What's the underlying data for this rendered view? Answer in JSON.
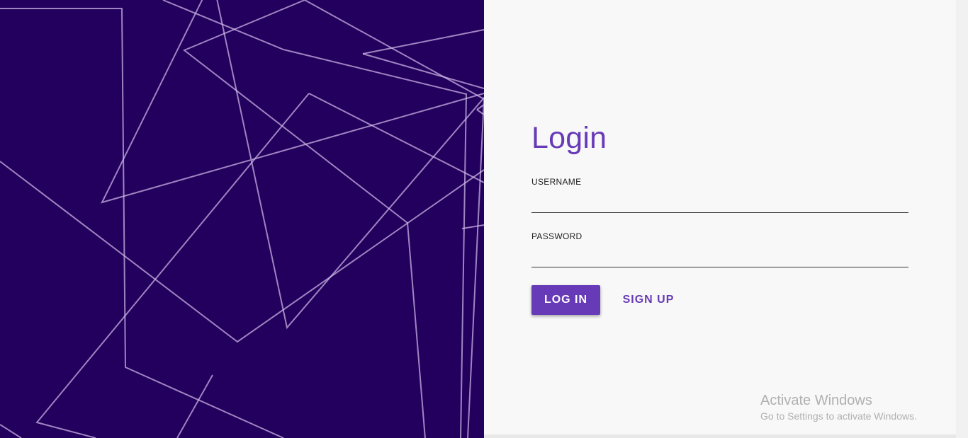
{
  "login": {
    "title": "Login",
    "username_label": "USERNAME",
    "username_value": "",
    "password_label": "PASSWORD",
    "password_value": "",
    "login_button": "LOG IN",
    "signup_button": "SIGN UP"
  },
  "watermark": {
    "title": "Activate Windows",
    "subtitle": "Go to Settings to activate Windows."
  },
  "colors": {
    "accent": "#673ab7",
    "panel_background": "#24005e",
    "page_background": "#f8f8f8"
  }
}
